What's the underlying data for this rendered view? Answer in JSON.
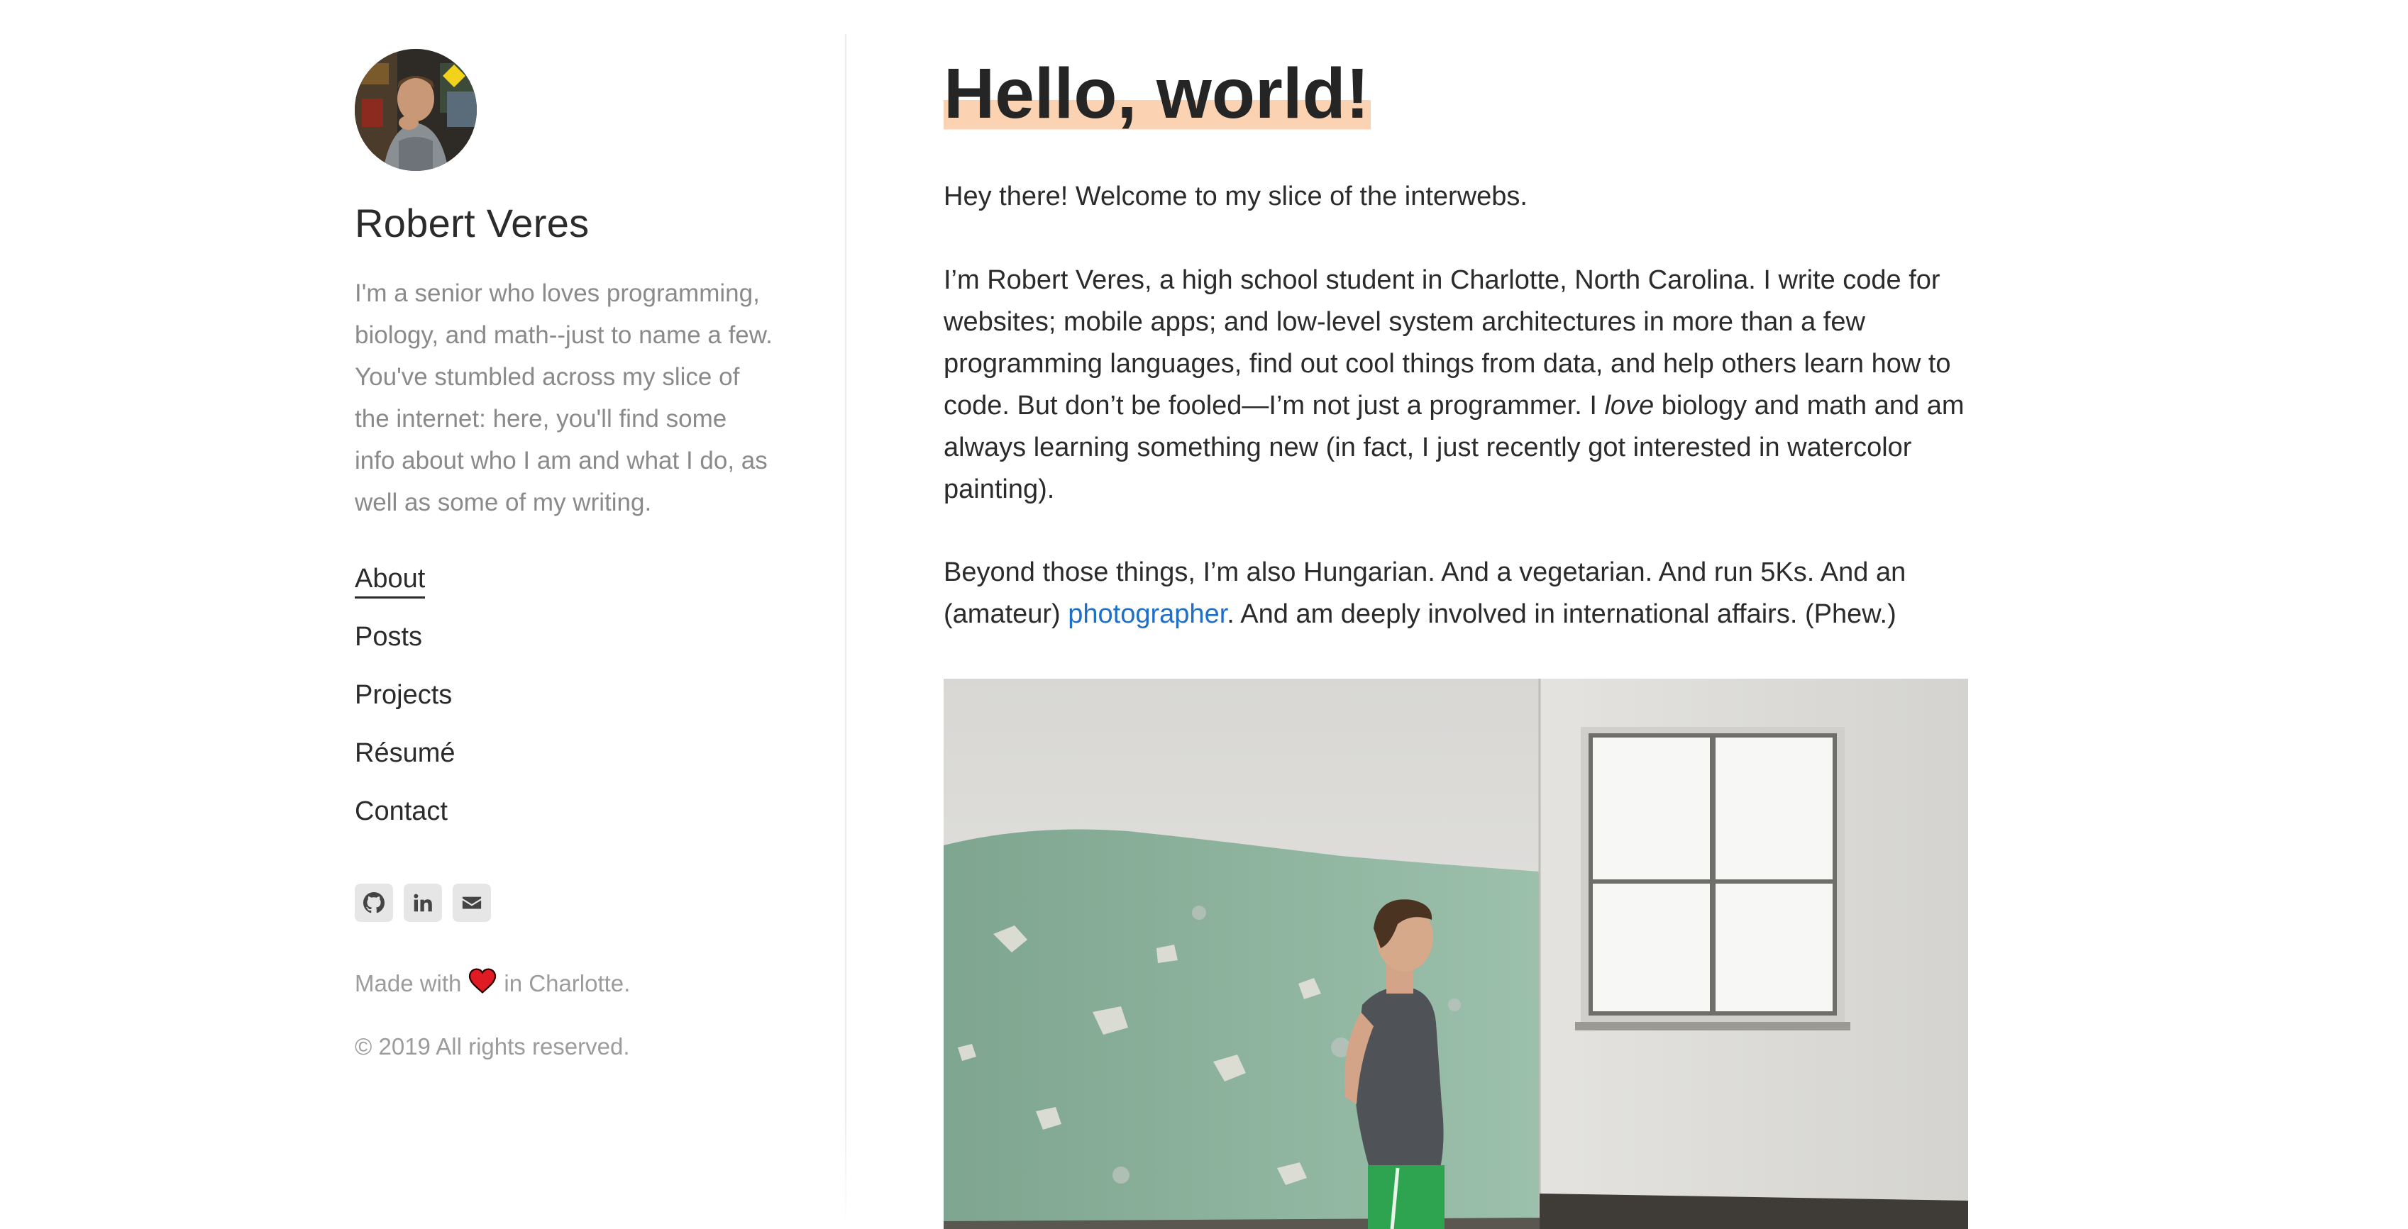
{
  "sidebar": {
    "avatar_icon": "profile-photo",
    "name": "Robert Veres",
    "bio": "I'm a senior who loves programming, biology, and math--just to name a few. You've stumbled across my slice of the internet: here, you'll find some info about who I am and what I do, as well as some of my writing.",
    "nav": [
      {
        "label": "About",
        "active": true
      },
      {
        "label": "Posts",
        "active": false
      },
      {
        "label": "Projects",
        "active": false
      },
      {
        "label": "Résumé",
        "active": false
      },
      {
        "label": "Contact",
        "active": false
      }
    ],
    "social": [
      {
        "icon": "github-icon"
      },
      {
        "icon": "linkedin-icon"
      },
      {
        "icon": "envelope-icon"
      }
    ],
    "made_with_prefix": "Made with",
    "made_with_suffix": "in Charlotte.",
    "heart_color": "#e01b24",
    "copyright": "© 2019 All rights reserved."
  },
  "main": {
    "title": "Hello, world!",
    "highlight_color": "#fbd3b3",
    "p1": "Hey there! Welcome to my slice of the interwebs.",
    "p2_before": "I’m Robert Veres, a high school student in Charlotte, North Carolina. I write code for websites; mobile apps; and low-level system architectures in more than a few programming languages, find out cool things from data, and help others learn how to code. But don’t be fooled—I’m not just a programmer. I ",
    "p2_em": "love",
    "p2_after": " biology and math and am always learning something new (in fact, I just recently got interested in watercolor painting).",
    "p3_before": "Beyond those things, I’m also Hungarian. And a vegetarian. And run 5Ks. And an (amateur) ",
    "p3_link": "photographer",
    "p3_after": ". And am deeply involved in international affairs. (Phew.)",
    "link_color": "#1e6fc7"
  }
}
